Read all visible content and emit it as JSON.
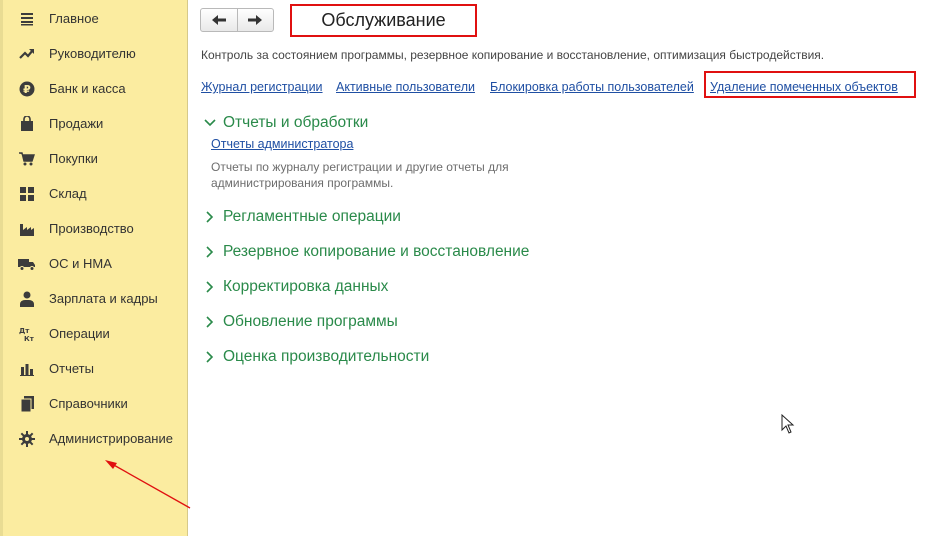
{
  "sidebar": {
    "items": [
      {
        "label": "Главное",
        "icon": "menu-lines-icon"
      },
      {
        "label": "Руководителю",
        "icon": "trend-up-icon"
      },
      {
        "label": "Банк и касса",
        "icon": "ruble-coin-icon"
      },
      {
        "label": "Продажи",
        "icon": "shopping-bag-icon"
      },
      {
        "label": "Покупки",
        "icon": "shopping-cart-icon"
      },
      {
        "label": "Склад",
        "icon": "warehouse-grid-icon"
      },
      {
        "label": "Производство",
        "icon": "factory-icon"
      },
      {
        "label": "ОС и НМА",
        "icon": "truck-icon"
      },
      {
        "label": "Зарплата и кадры",
        "icon": "person-icon"
      },
      {
        "label": "Операции",
        "icon": "dt-kt-icon",
        "icon_text": "Дт\nКт"
      },
      {
        "label": "Отчеты",
        "icon": "bar-chart-icon"
      },
      {
        "label": "Справочники",
        "icon": "books-icon"
      },
      {
        "label": "Администрирование",
        "icon": "gear-icon"
      }
    ]
  },
  "header": {
    "title": "Обслуживание",
    "back_icon": "arrow-left-icon",
    "forward_icon": "arrow-right-icon"
  },
  "description": "Контроль за состоянием программы, резервное копирование и восстановление, оптимизация быстродействия.",
  "links": [
    "Журнал регистрации",
    "Активные пользователи",
    "Блокировка работы пользователей",
    "Удаление помеченных объектов"
  ],
  "sections": [
    {
      "title": "Отчеты и обработки",
      "expanded": true
    },
    {
      "title": "Регламентные операции",
      "expanded": false
    },
    {
      "title": "Резервное копирование и восстановление",
      "expanded": false
    },
    {
      "title": "Корректировка данных",
      "expanded": false
    },
    {
      "title": "Обновление программы",
      "expanded": false
    },
    {
      "title": "Оценка производительности",
      "expanded": false
    }
  ],
  "reports_section": {
    "link": "Отчеты администратора",
    "description": "Отчеты по журналу регистрации и другие отчеты для администрирования программы."
  },
  "colors": {
    "sidebar_bg": "#fbeca0",
    "section_green": "#2a8a4a",
    "link_blue": "#1f4fa3",
    "annotation_red": "#e01010"
  }
}
